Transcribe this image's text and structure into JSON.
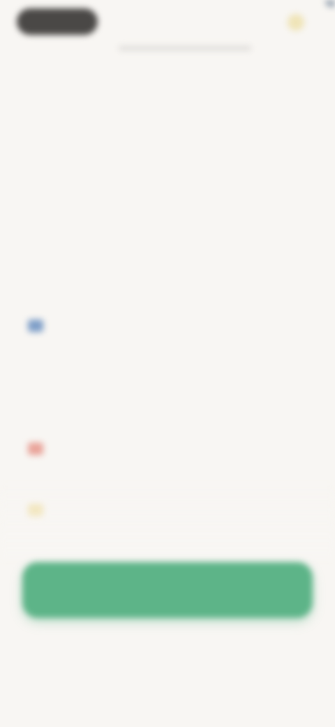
{
  "header": {
    "pill_label": "",
    "icon": "sun-icon",
    "subtitle": ""
  },
  "content": {
    "heading": "",
    "paragraphs": [
      {
        "icon": "",
        "text": ""
      },
      {
        "icon": "",
        "text": ""
      },
      {
        "icon": "",
        "text": ""
      },
      {
        "icon": "blue-badge-icon",
        "text": ""
      },
      {
        "icon": "",
        "text": ""
      },
      {
        "icon": "red-badge-icon",
        "text": ""
      },
      {
        "icon": "yellow-badge-icon",
        "text": ""
      }
    ]
  },
  "cta": {
    "label": ""
  },
  "footnote": "",
  "nav": {
    "items": [
      "",
      "",
      ""
    ]
  },
  "colors": {
    "background": "#f8f6f3",
    "primary_button": "#5db488",
    "pill": "#4a4846"
  }
}
